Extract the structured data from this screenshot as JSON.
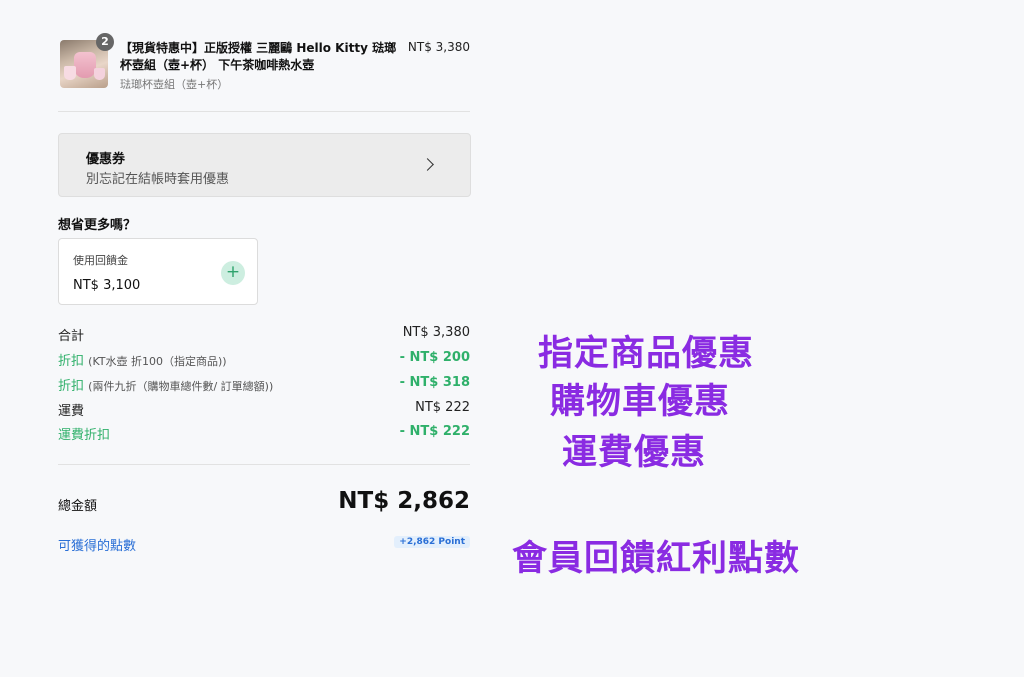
{
  "product": {
    "title": "【現貨特惠中】正版授權 三麗鷗 Hello Kitty 琺瑯杯壺組（壺+杯） 下午茶咖啡熱水壺",
    "variant": "琺瑯杯壺組（壺+杯）",
    "price": "NT$ 3,380",
    "quantity": "2"
  },
  "coupon": {
    "title": "優惠券",
    "subtitle": "別忘記在結帳時套用優惠"
  },
  "savings": {
    "heading": "想省更多嗎？",
    "reward_label": "使用回饋金",
    "reward_value": "NT$ 3,100",
    "add_icon": "+"
  },
  "summary": {
    "subtotal_label": "合計",
    "subtotal_value": "NT$ 3,380",
    "discount1_label": "折扣",
    "discount1_note": "(KT水壺 折100（指定商品))",
    "discount1_value": "- NT$ 200",
    "discount2_label": "折扣",
    "discount2_note": "(兩件九折（購物車總件數/ 訂單總額))",
    "discount2_value": "- NT$ 318",
    "shipping_label": "運費",
    "shipping_value": "NT$ 222",
    "shipping_discount_label": "運費折扣",
    "shipping_discount_value": "- NT$ 222",
    "total_label": "總金額",
    "total_value": "NT$ 2,862",
    "points_label": "可獲得的點數",
    "points_value": "+2,862 Point"
  },
  "annotations": {
    "a1": "指定商品優惠",
    "a2": "購物車優惠",
    "a3": "運費優惠",
    "a4": "會員回饋紅利點數"
  },
  "colors": {
    "green": "#2fb06a",
    "blue": "#2a6fd6",
    "annotation": "#8a2be2"
  }
}
